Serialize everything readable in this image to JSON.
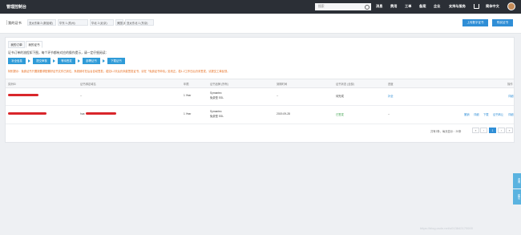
{
  "header": {
    "brand": "管理控制台",
    "search_placeholder": "搜索",
    "nav": [
      "消息",
      "费用",
      "工单",
      "备案",
      "企业",
      "支持与服务"
    ],
    "lang": "简体中文"
  },
  "tabs": {
    "title": "我的证书",
    "chips": [
      "亚太东南 2 (新加坡)",
      "华东 1 (杭州)",
      "华北 2 (北京)",
      "美国 (硅谷)",
      "亚太东北 1 (东京)"
    ],
    "buy_button": "购买证书",
    "upload_button": "上传数字证书"
  },
  "subtabs": [
    "我的订单",
    "我的证书"
  ],
  "flow": {
    "title": "证书订单的流程如下图，每个环节都有对应的操作提示，请一定仔细阅读：",
    "steps": [
      "补全信息",
      "提交审核",
      "等待签发",
      "部署证书",
      "下载证书"
    ]
  },
  "notice": "特别提示：免费证书只要按要求配置好证书文件已到位，系统就可在后台自动签发；若如1-2天后仍未能签发证书，请在「免费证书申请」处改正。若1-2工作日后仍未签发，请提交工单反馈。",
  "table": {
    "headers": [
      "实例ID",
      "证书绑定域名",
      "年限",
      "证书品牌 (所有)",
      "到期时间",
      "证书状态 (全部)",
      "进度",
      "操作"
    ],
    "rows": [
      {
        "years": "1 Year",
        "brand": "Symantec",
        "type": "免费型 SSL",
        "expire": "--",
        "status": "待完成",
        "progress": "补全",
        "domain": "--",
        "actions": [
          "详细"
        ]
      },
      {
        "years": "1 Year",
        "brand": "Symantec",
        "type": "免费型 SSL",
        "expire": "2019-09-28",
        "status": "已签发",
        "progress": "--",
        "domain_prefix": "hua",
        "actions": [
          "撤销",
          "详细",
          "下载",
          "证书转让",
          "详细"
        ]
      }
    ]
  },
  "pagination": {
    "summary": "共有2条，每页显示：20条",
    "pages": [
      "«",
      "‹",
      "1",
      "›",
      "»"
    ],
    "current": "1"
  },
  "side_float": [
    "咨询",
    "建议"
  ],
  "watermark": "https://blog.csdn.net/u013842170000"
}
